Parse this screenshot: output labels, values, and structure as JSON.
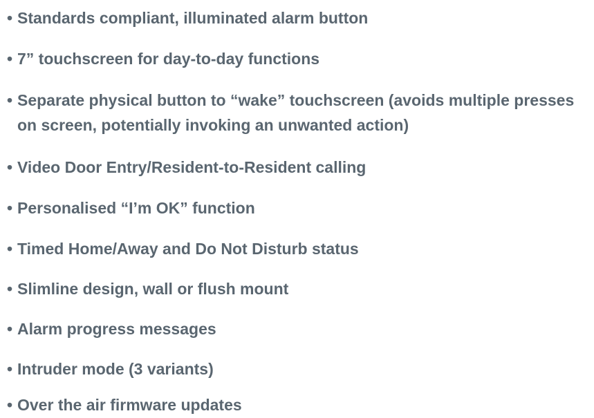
{
  "features": {
    "bullet": "•",
    "items": [
      "Standards compliant, illuminated alarm button",
      "7” touchscreen for day-to-day functions",
      "Separate physical button to “wake” touchscreen (avoids multiple presses on screen, potentially invoking an unwanted action)",
      "Video Door Entry/Resident-to-Resident calling",
      "Personalised “I’m OK” function",
      "Timed Home/Away and Do Not Disturb status",
      "Slimline design, wall or flush mount",
      "Alarm progress messages",
      "Intruder mode (3 variants)",
      "Over the air firmware updates"
    ]
  },
  "colors": {
    "text": "#5a6670",
    "background": "#ffffff"
  }
}
